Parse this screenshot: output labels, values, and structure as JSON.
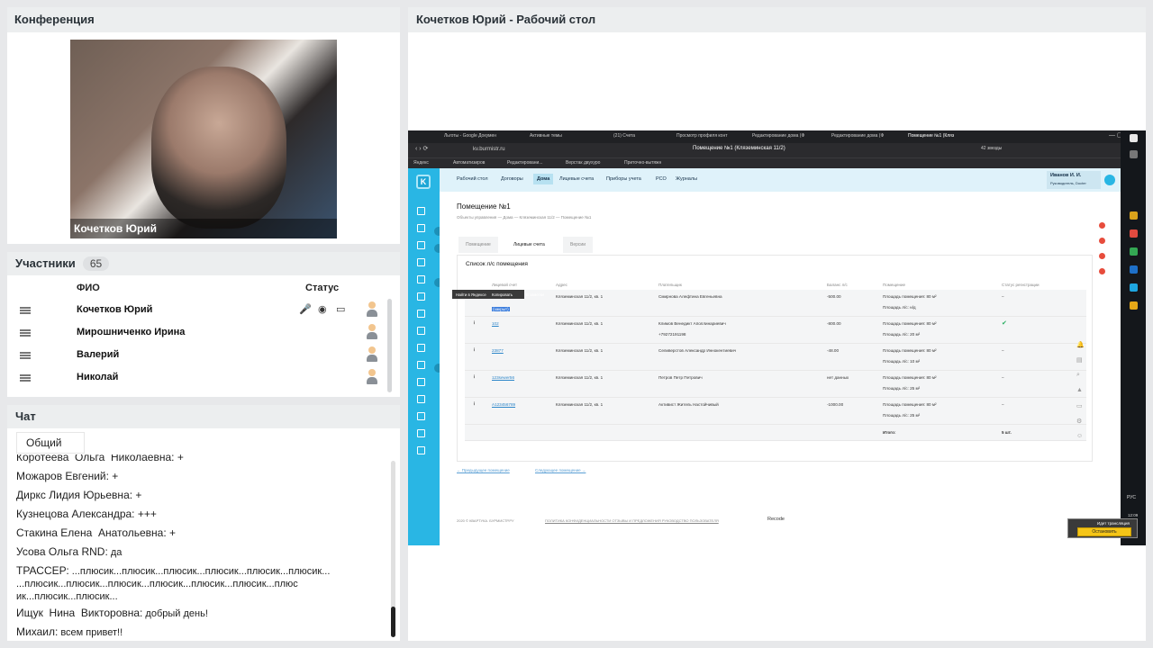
{
  "conference": {
    "title": "Конференция",
    "video_name": "Кочетков Юрий"
  },
  "participants": {
    "title": "Участники",
    "count": "65",
    "col_name": "ФИО",
    "col_status": "Статус",
    "rows": [
      {
        "name": "Кочетков Юрий"
      },
      {
        "name": "Мирошниченко Ирина"
      },
      {
        "name": "Валерий"
      },
      {
        "name": "Николай"
      }
    ]
  },
  "chat": {
    "title": "Чат",
    "tab": "Общий",
    "messages": [
      {
        "author": "Коротеева  Ольга  Николаевна:",
        "text": " +"
      },
      {
        "author": "Можаров Евгений:",
        "text": " +"
      },
      {
        "author": "Диркс Лидия Юрьевна:",
        "text": " +"
      },
      {
        "author": "Кузнецова Александра:",
        "text": " +++"
      },
      {
        "author": "Стакина Елена  Анатольевна:",
        "text": " +"
      },
      {
        "author": "Усова Ольга RND:",
        "text": " да"
      },
      {
        "author": "ТРАССЕР:",
        "text": " ...плюсик...плюсик...плюсик...плюсик...плюсик...плюсик...\n...плюсик...плюсик...плюсик...плюсик...плюсик...плюсик...плюс\nик...плюсик...плюсик..."
      },
      {
        "author": "Ищук  Нина  Викторовна:",
        "text": " добрый день!"
      },
      {
        "author": "Михаил:",
        "text": " всем привет!!"
      }
    ]
  },
  "share": {
    "title": "Кочетков Юрий - Рабочий стол",
    "browser": {
      "tabs": [
        "Льготы - Google Докумен",
        "Активные темы",
        "(21) Счета",
        "Просмотр профиля конт",
        "Редактирование дома (Ф",
        "Редактирование дома (Ф",
        "Помещение №1 (Кляз"
      ],
      "url": "kv.burmistr.ru",
      "page_title": "Помещение №1 (Кляземинская 11/2)",
      "bookmarks": [
        "Яндекс",
        "Автоматизиров",
        "Редактировани...",
        "Верстак двухуро",
        "Приточно-вытяжн"
      ],
      "ext_counter": "42 звезды"
    },
    "app": {
      "nav": [
        "Рабочий стол",
        "Договоры",
        "Дома",
        "Лицевые счета",
        "Приборы учета",
        "РСО",
        "Журналы"
      ],
      "active_nav": "Дома",
      "user_name": "Иванов И. И.",
      "user_role": "Руководитель, Docter",
      "page_h1": "Помещение №1",
      "breadcrumb": "Объекты управления — Дома — Кляземинская 11/2 — Помещение №1",
      "tabs": [
        "Помещение",
        "Лицевые счета",
        "Версии"
      ],
      "active_tab": "Лицевые счета",
      "list_title": "Список л/с помещения",
      "columns": [
        "Лицевой счет",
        "Адрес",
        "Плательщик",
        "Баланс л/с",
        "Помещение",
        "Статус регистрации"
      ],
      "context_menu": [
        "Найти в Яндексе",
        "Копировать",
        "В заметки"
      ],
      "rows": [
        {
          "account": "(закрыт)",
          "address": "Кляземинская 11/2, кв. 1",
          "payer": "Смирнова Алефтина Евгеньевна",
          "balance": "-500.00",
          "area": "Площадь помещения: 80 м²",
          "area2": "Площадь л/с: н/д",
          "status": "–"
        },
        {
          "account": "102",
          "address": "Кляземинская 11/2, кв. 1",
          "payer": "Климов Венедикт Аполлинариевич",
          "payer2": "+79272191198",
          "balance": "-800.00",
          "area": "Площадь помещения: 80 м²",
          "area2": "Площадь л/с: 20 м²",
          "status": "✔"
        },
        {
          "account": "23877",
          "address": "Кляземинская 11/2, кв. 1",
          "payer": "Селиверстов Александр Иннокентиевич",
          "balance": "-48.00",
          "area": "Площадь помещения: 80 м²",
          "area2": "Площадь л/с: 10 м²",
          "status": "–"
        },
        {
          "account": "123sewer56",
          "address": "Кляземинская 11/2, кв. 1",
          "payer": "Петров Петр Петрович",
          "balance": "нет данных",
          "area": "Площадь помещения: 80 м²",
          "area2": "Площадь л/с: 25 м²",
          "status": "–"
        },
        {
          "account": "A123456789",
          "address": "Кляземинская 11/2, кв. 1",
          "payer": "Активист Житель Настойчивый",
          "balance": "-1000.00",
          "area": "Площадь помещения: 80 м²",
          "area2": "Площадь л/с: 25 м²",
          "status": "–"
        }
      ],
      "total_label": "Итого:",
      "total_value": "5 шт.",
      "prev_link": "← Предыдущее помещение",
      "next_link": "Следующее помещение →",
      "footer_copy": "2020 © КВАРТУКА. БУРМИСТР.РУ",
      "footer_links": "ПОЛИТИКА КОНФИДЕНЦИАЛЬНОСТИ   ОТЗЫВЫ И ПРЕДЛОЖЕНИЯ   РУКОВОДСТВО ПОЛЬЗОВАТЕЛЯ",
      "footer_brand": "Recode"
    },
    "taskbar": {
      "lang": "РУС",
      "time": "12:09"
    },
    "overlay": {
      "label": "Идет трансляция",
      "button": "Остановить"
    }
  }
}
